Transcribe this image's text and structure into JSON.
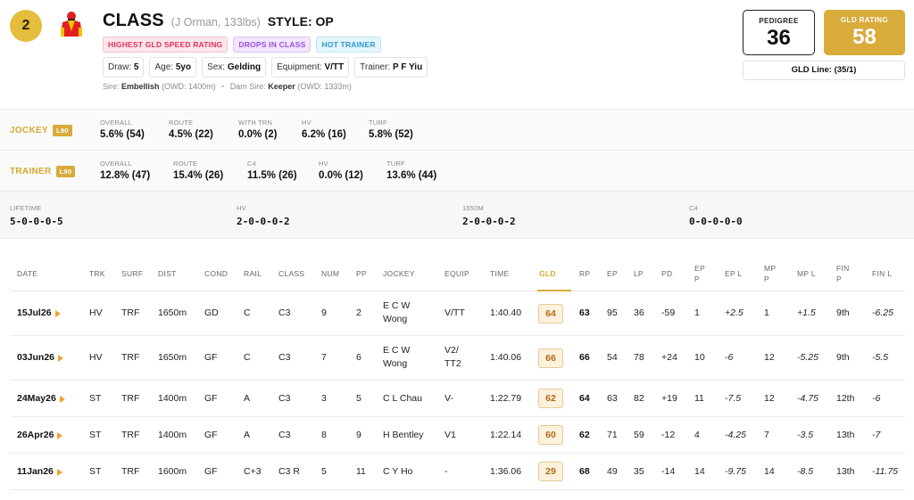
{
  "header": {
    "number": "2",
    "horse_name": "CLASS",
    "horse_sub": "(J Orman, 133lbs)",
    "style": "STYLE: OP",
    "tags": [
      "HIGHEST GLD SPEED RATING",
      "DROPS IN CLASS",
      "HOT TRAINER"
    ],
    "facts": {
      "draw_label": "Draw:",
      "draw": "5",
      "age_label": "Age:",
      "age": "5yo",
      "sex_label": "Sex:",
      "sex": "Gelding",
      "equip_label": "Equipment:",
      "equip": "V/TT",
      "trainer_label": "Trainer:",
      "trainer": "P F Yiu"
    },
    "sire_label": "Sire:",
    "sire": "Embellish",
    "sire_owd": "(OWD: 1400m)",
    "dam_sire_label": "Dam Sire:",
    "dam_sire": "Keeper",
    "dam_sire_owd": "(OWD: 1333m)",
    "pedigree_label": "PEDIGREE",
    "pedigree_value": "36",
    "gld_rating_label": "GLD RATING",
    "gld_rating_value": "58",
    "gld_line": "GLD Line: (35/1)"
  },
  "jockey_stats": {
    "title": "JOCKEY",
    "badge": "L90",
    "stats": [
      {
        "label": "OVERALL",
        "value": "5.6% (54)"
      },
      {
        "label": "ROUTE",
        "value": "4.5% (22)"
      },
      {
        "label": "WITH TRN",
        "value": "0.0% (2)"
      },
      {
        "label": "HV",
        "value": "6.2% (16)"
      },
      {
        "label": "TURF",
        "value": "5.8% (52)"
      }
    ]
  },
  "trainer_stats": {
    "title": "TRAINER",
    "badge": "L90",
    "stats": [
      {
        "label": "OVERALL",
        "value": "12.8% (47)"
      },
      {
        "label": "ROUTE",
        "value": "15.4% (26)"
      },
      {
        "label": "C4",
        "value": "11.5% (26)"
      },
      {
        "label": "HV",
        "value": "0.0% (12)"
      },
      {
        "label": "TURF",
        "value": "13.6% (44)"
      }
    ]
  },
  "records": [
    {
      "label": "LIFETIME",
      "value": "5-0-0-0-5"
    },
    {
      "label": "HV",
      "value": "2-0-0-0-2"
    },
    {
      "label": "1650M",
      "value": "2-0-0-0-2"
    },
    {
      "label": "C4",
      "value": "0-0-0-0-0"
    }
  ],
  "table": {
    "headers": {
      "date": "DATE",
      "trk": "TRK",
      "surf": "SURF",
      "dist": "DIST",
      "cond": "COND",
      "rail": "RAIL",
      "class": "CLASS",
      "num": "NUM",
      "pp": "PP",
      "jockey": "JOCKEY",
      "equip": "EQUIP",
      "time": "TIME",
      "gld": "GLD",
      "rp": "RP",
      "ep": "EP",
      "lp": "LP",
      "pd": "PD",
      "epp1": "EP",
      "epp2": "P",
      "epl": "EP L",
      "mpp1": "MP",
      "mpp2": "P",
      "mpl": "MP L",
      "finp1": "FIN",
      "finp2": "P",
      "finl": "FIN L"
    },
    "rows": [
      {
        "date": "15Jul26",
        "trk": "HV",
        "surf": "TRF",
        "dist": "1650m",
        "cond": "GD",
        "rail": "C",
        "class": "C3",
        "num": "9",
        "pp": "2",
        "jockey1": "E C W",
        "jockey2": "Wong",
        "equip1": "V/TT",
        "equip2": "",
        "time": "1:40.40",
        "gld": "64",
        "rp": "63",
        "ep": "95",
        "lp": "36",
        "pd": "-59",
        "epp": "1",
        "epl": "+2.5",
        "mpp": "1",
        "mpl": "+1.5",
        "finp": "9th",
        "finl": "-6.25"
      },
      {
        "date": "03Jun26",
        "trk": "HV",
        "surf": "TRF",
        "dist": "1650m",
        "cond": "GF",
        "rail": "C",
        "class": "C3",
        "num": "7",
        "pp": "6",
        "jockey1": "E C W",
        "jockey2": "Wong",
        "equip1": "V2/",
        "equip2": "TT2",
        "time": "1:40.06",
        "gld": "66",
        "rp": "66",
        "ep": "54",
        "lp": "78",
        "pd": "+24",
        "epp": "10",
        "epl": "-6",
        "mpp": "12",
        "mpl": "-5.25",
        "finp": "9th",
        "finl": "-5.5"
      },
      {
        "date": "24May26",
        "trk": "ST",
        "surf": "TRF",
        "dist": "1400m",
        "cond": "GF",
        "rail": "A",
        "class": "C3",
        "num": "3",
        "pp": "5",
        "jockey1": "C L Chau",
        "jockey2": "",
        "equip1": "V-",
        "equip2": "",
        "time": "1:22.79",
        "gld": "62",
        "rp": "64",
        "ep": "63",
        "lp": "82",
        "pd": "+19",
        "epp": "11",
        "epl": "-7.5",
        "mpp": "12",
        "mpl": "-4.75",
        "finp": "12th",
        "finl": "-6"
      },
      {
        "date": "26Apr26",
        "trk": "ST",
        "surf": "TRF",
        "dist": "1400m",
        "cond": "GF",
        "rail": "A",
        "class": "C3",
        "num": "8",
        "pp": "9",
        "jockey1": "H Bentley",
        "jockey2": "",
        "equip1": "V1",
        "equip2": "",
        "time": "1:22.14",
        "gld": "60",
        "rp": "62",
        "ep": "71",
        "lp": "59",
        "pd": "-12",
        "epp": "4",
        "epl": "-4.25",
        "mpp": "7",
        "mpl": "-3.5",
        "finp": "13th",
        "finl": "-7"
      },
      {
        "date": "11Jan26",
        "trk": "ST",
        "surf": "TRF",
        "dist": "1600m",
        "cond": "GF",
        "rail": "C+3",
        "class": "C3 R",
        "num": "5",
        "pp": "11",
        "jockey1": "C Y Ho",
        "jockey2": "",
        "equip1": "-",
        "equip2": "",
        "time": "1:36.06",
        "gld": "29",
        "rp": "68",
        "ep": "49",
        "lp": "35",
        "pd": "-14",
        "epp": "14",
        "epl": "-9.75",
        "mpp": "14",
        "mpl": "-8.5",
        "finp": "13th",
        "finl": "-11.75"
      }
    ]
  },
  "colors": {
    "gold": "#d8ab3a",
    "accent_orange": "#f0a030"
  }
}
